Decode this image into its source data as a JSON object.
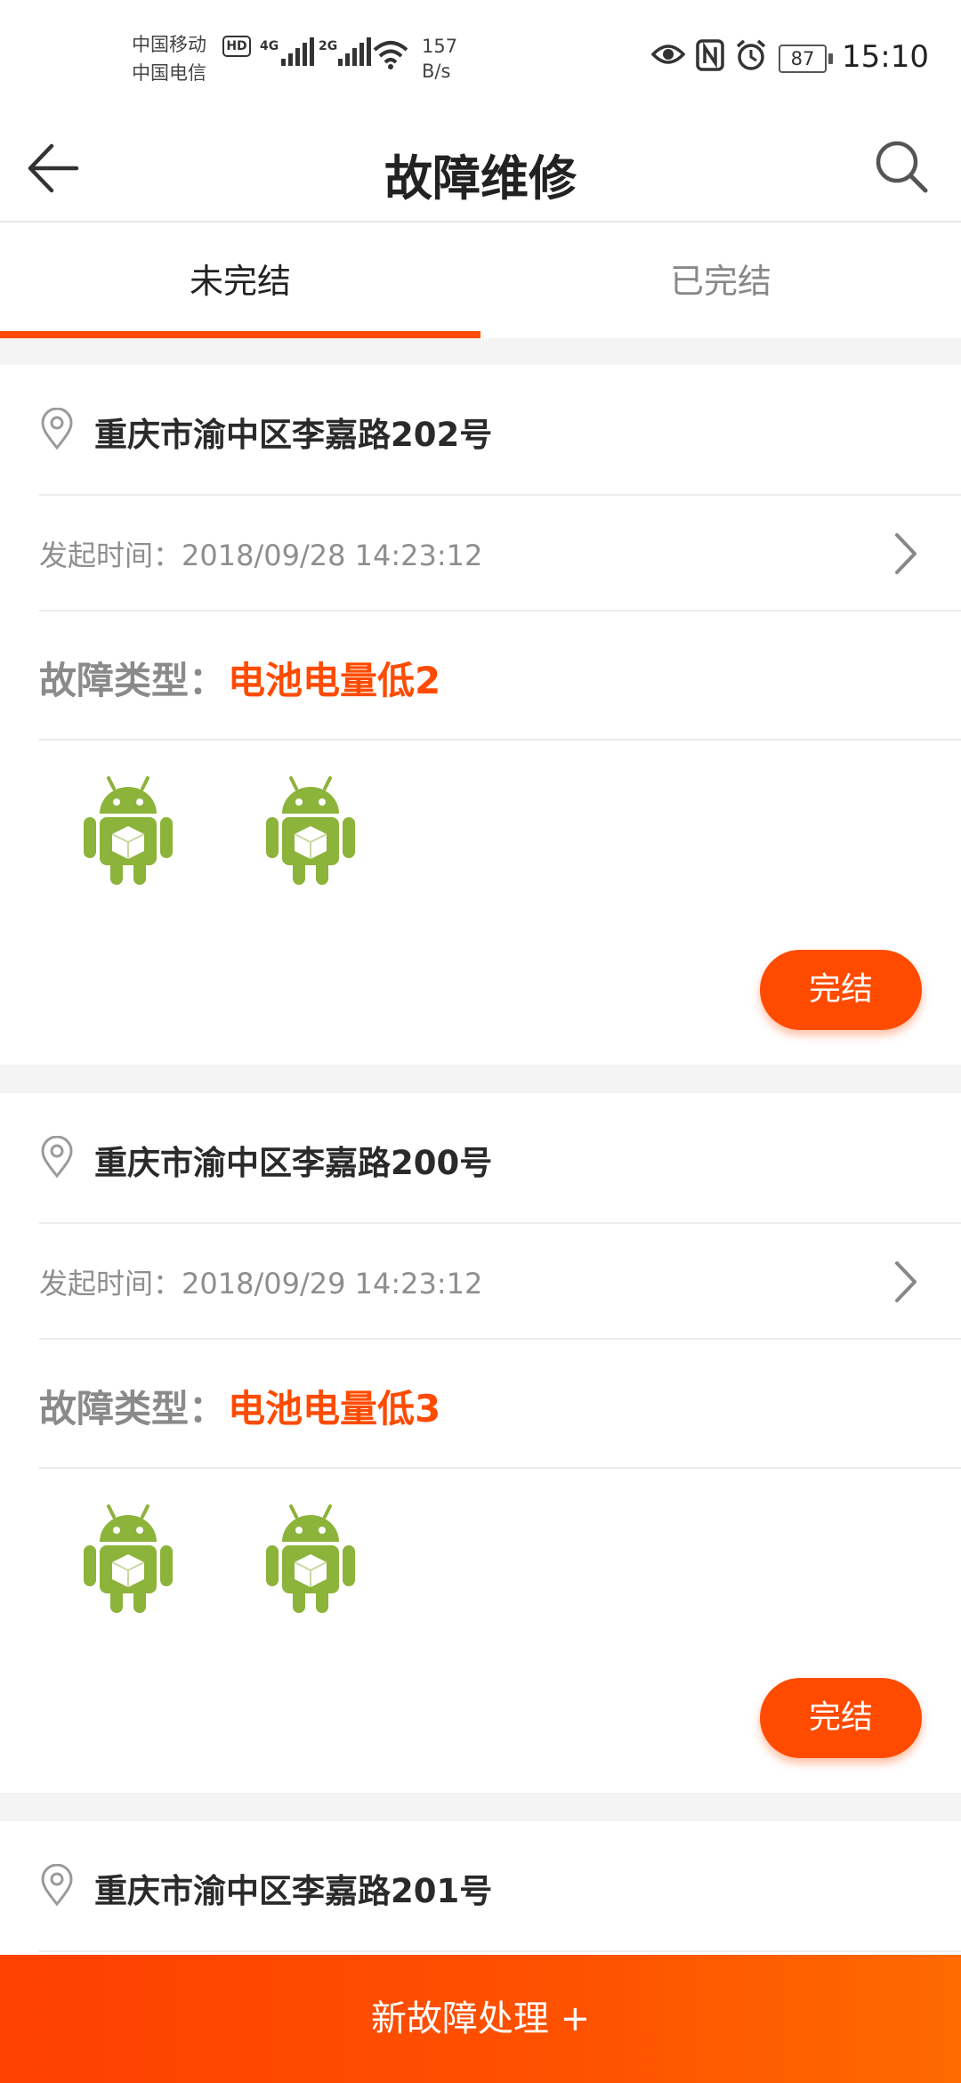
{
  "status_bar": {
    "carrier1": "中国移动",
    "carrier2": "中国电信",
    "hd_badge": "HD",
    "net1": "4G",
    "net2": "2G",
    "speed_value": "157",
    "speed_unit": "B/s",
    "battery": "87",
    "time": "15:10",
    "icons": [
      "eye-icon",
      "nfc-icon",
      "alarm-icon",
      "battery-icon",
      "wifi-icon",
      "signal-icon"
    ]
  },
  "header": {
    "title": "故障维修",
    "back_icon": "arrow-left-icon",
    "search_icon": "search-icon"
  },
  "tabs": [
    {
      "label": "未完结",
      "active": true
    },
    {
      "label": "已完结",
      "active": false
    }
  ],
  "cards": [
    {
      "address": "重庆市渝中区李嘉路202号",
      "time_label": "发起时间：",
      "time_value": "2018/09/28  14:23:12",
      "type_label": "故障类型：",
      "type_value": "电池电量低2",
      "action": "完结"
    },
    {
      "address": "重庆市渝中区李嘉路200号",
      "time_label": "发起时间：",
      "time_value": "2018/09/29  14:23:12",
      "type_label": "故障类型：",
      "type_value": "电池电量低3",
      "action": "完结"
    },
    {
      "address": "重庆市渝中区李嘉路201号"
    }
  ],
  "bottom": {
    "label": "新故障处理 +"
  },
  "colors": {
    "accent": "#fe4b00",
    "robot_green": "#8cb33a"
  }
}
